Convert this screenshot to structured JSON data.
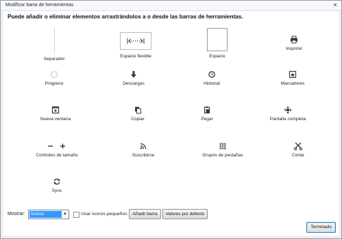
{
  "window": {
    "title": "Modificar barra de herramientas",
    "close_glyph": "✕"
  },
  "instruction": "Puede añadir o eliminar elementos arrastrándolos a o desde las barras de herramientas.",
  "items": {
    "separador": "Separador",
    "espacio_flexible": "Espacio flexible",
    "espacio": "Espacio",
    "imprimir": "Imprimir",
    "progreso": "Progreso",
    "descargas": "Descargas",
    "historial": "Historial",
    "marcadores": "Marcadores",
    "nueva_ventana": "Nueva ventana",
    "copiar": "Copiar",
    "pegar": "Pegar",
    "pantalla_completa": "Pantalla completa",
    "controles_tamano": "Controles de tamaño",
    "suscribirse": "Suscribirse",
    "grupos_pestanas": "Grupos de pestañas",
    "cortar": "Cortar",
    "sync": "Sync"
  },
  "icons": [
    "separator-line",
    "flexible-space-icon",
    "space-box",
    "print-icon",
    "progress-throbber-icon",
    "download-arrow-icon",
    "history-clock-icon",
    "bookmarks-icon",
    "new-window-icon",
    "copy-icon",
    "paste-icon",
    "fullscreen-arrows-icon",
    "zoom-minus-icon",
    "zoom-plus-icon",
    "feed-icon",
    "tab-groups-icon",
    "scissors-icon",
    "sync-icon"
  ],
  "controls": {
    "mostrar_label": "Mostrar:",
    "mostrar_value": "Iconos",
    "small_icons_label": "Usar iconos pequeños",
    "small_icons_checked": false,
    "add_toolbar_label": "Añadir barra",
    "restore_defaults_label": "Valores por defecto",
    "done_label": "Terminado"
  },
  "colors": {
    "select_highlight": "#3399ff",
    "icon_dark": "#3a3a3a"
  }
}
